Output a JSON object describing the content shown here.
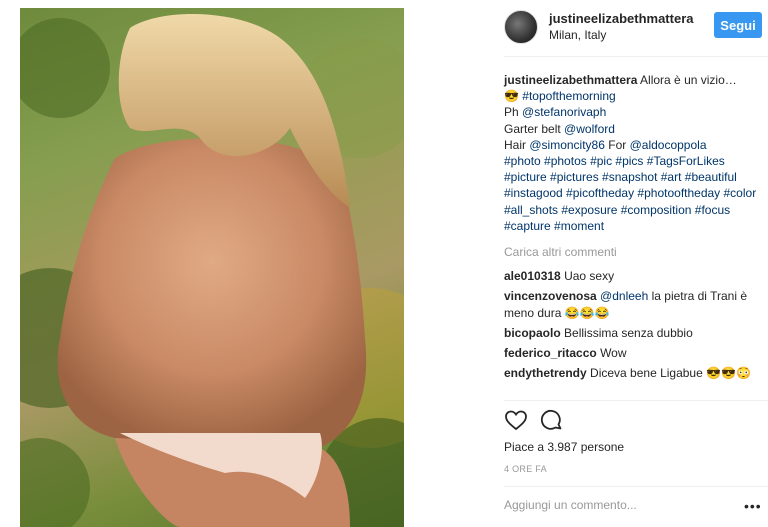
{
  "header": {
    "username": "justineelizabethmattera",
    "location": "Milan, Italy",
    "follow_label": "Segui"
  },
  "caption": {
    "username": "justineelizabethmattera",
    "text": "Allora è un vizio…",
    "emoji": "😎",
    "hashtag_first": "#topofthemorning",
    "ph_prefix": "Ph",
    "ph_handle": "@stefanorivaph",
    "garter_prefix": "Garter belt",
    "garter_handle": "@wolford",
    "hair_prefix": "Hair",
    "hair_handle": "@simoncity86",
    "for_word": "For",
    "for_handle": "@aldocoppola",
    "hashtags": "#photo #photos #pic #pics #TagsForLikes #picture #pictures #snapshot #art #beautiful #instagood #picoftheday #photooftheday #color #all_shots #exposure #composition #focus #capture #moment"
  },
  "load_more": "Carica altri commenti",
  "comments": [
    {
      "user": "ale010318",
      "text": "Uao sexy"
    },
    {
      "user": "vincenzovenosa",
      "mention": "@dnleeh",
      "text": "la pietra di Trani è meno dura 😂😂😂"
    },
    {
      "user": "bicopaolo",
      "text": "Bellissima senza dubbio"
    },
    {
      "user": "federico_ritacco",
      "text": "Wow"
    },
    {
      "user": "endythetrendy",
      "text": "Diceva bene Ligabue 😎😎😳"
    }
  ],
  "icons": {
    "like": "heart-icon",
    "comment": "comment-bubble-icon",
    "options": "more-options-icon"
  },
  "likes_text": "Piace a 3.987 persone",
  "time_text": "4 ORE FA",
  "add_comment_placeholder": "Aggiungi un commento...",
  "options_label": "•••",
  "colors": {
    "follow_button": "#3897f0",
    "link": "#003569",
    "muted": "#999999"
  }
}
